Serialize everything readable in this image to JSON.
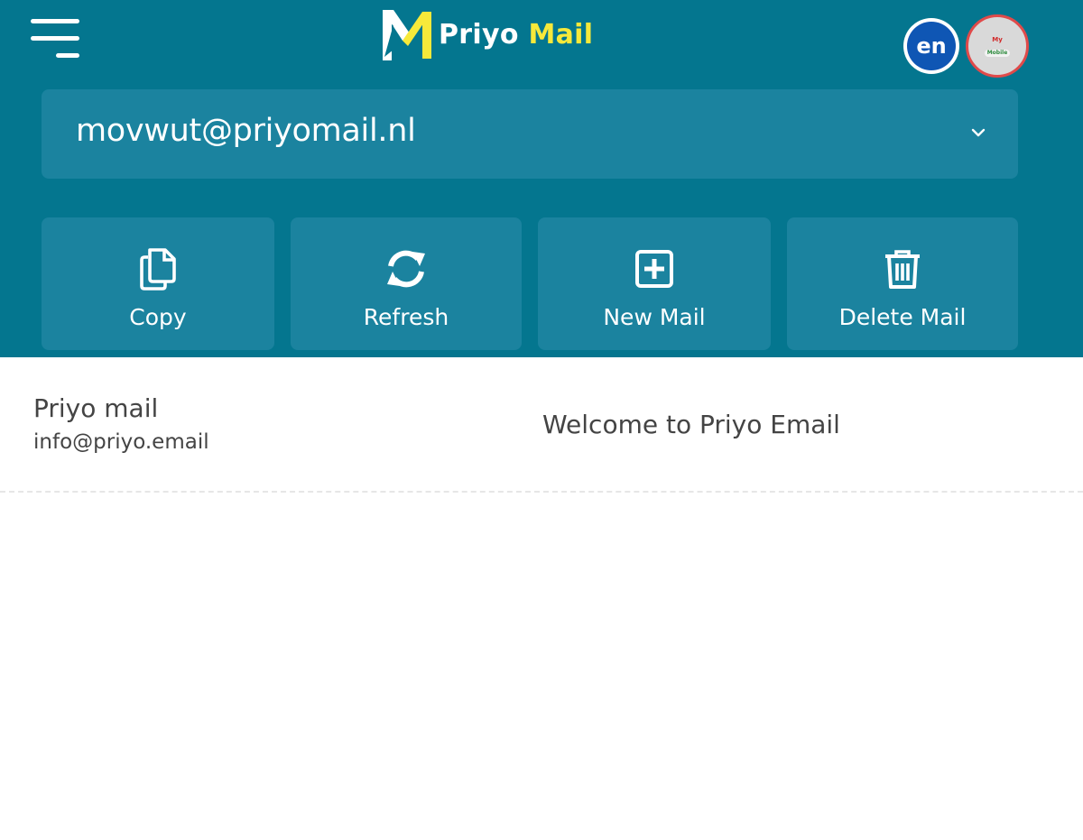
{
  "app": {
    "logo_text_white": "Priyo",
    "logo_text_yellow": "Mail",
    "language_code": "en",
    "avatar_line1": "My",
    "avatar_line2": "Mobile"
  },
  "colors": {
    "header_bg": "#04768f",
    "panel_bg": "#1b839f",
    "accent_yellow": "#f7e93a",
    "lang_badge": "#0f56b4"
  },
  "email_selector": {
    "current_address": "movwut@priyomail.nl",
    "icon": "chevron-down-icon"
  },
  "actions": [
    {
      "label": "Copy",
      "icon": "copy-icon"
    },
    {
      "label": "Refresh",
      "icon": "refresh-icon"
    },
    {
      "label": "New Mail",
      "icon": "plus-square-icon"
    },
    {
      "label": "Delete Mail",
      "icon": "trash-icon"
    }
  ],
  "inbox": [
    {
      "sender_name": "Priyo mail",
      "sender_email": "info@priyo.email",
      "subject": "Welcome to Priyo Email"
    }
  ]
}
